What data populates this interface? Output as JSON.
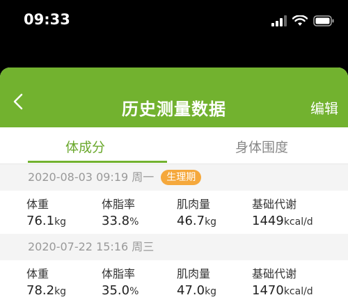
{
  "status_bar": {
    "time": "09:33",
    "icons": [
      "signal-icon",
      "wifi-icon",
      "battery-icon"
    ]
  },
  "header": {
    "title": "历史测量数据",
    "edit_label": "编辑",
    "bg_color": "#72b22f"
  },
  "tabs": [
    {
      "label": "体成分",
      "active": true
    },
    {
      "label": "身体围度",
      "active": false
    }
  ],
  "records": [
    {
      "date": "2020-08-03 09:19 周一",
      "badge": "生理期",
      "metrics": [
        {
          "label": "体重",
          "value": "76.1",
          "unit": "kg"
        },
        {
          "label": "体脂率",
          "value": "33.8",
          "unit": "%"
        },
        {
          "label": "肌肉量",
          "value": "46.7",
          "unit": "kg"
        },
        {
          "label": "基础代谢",
          "value": "1449",
          "unit": "kcal/d"
        }
      ]
    },
    {
      "date": "2020-07-22 15:16 周三",
      "badge": "",
      "metrics": [
        {
          "label": "体重",
          "value": "78.2",
          "unit": "kg"
        },
        {
          "label": "体脂率",
          "value": "35.0",
          "unit": "%"
        },
        {
          "label": "肌肉量",
          "value": "47.0",
          "unit": "kg"
        },
        {
          "label": "基础代谢",
          "value": "1470",
          "unit": "kcal/d"
        }
      ]
    }
  ]
}
